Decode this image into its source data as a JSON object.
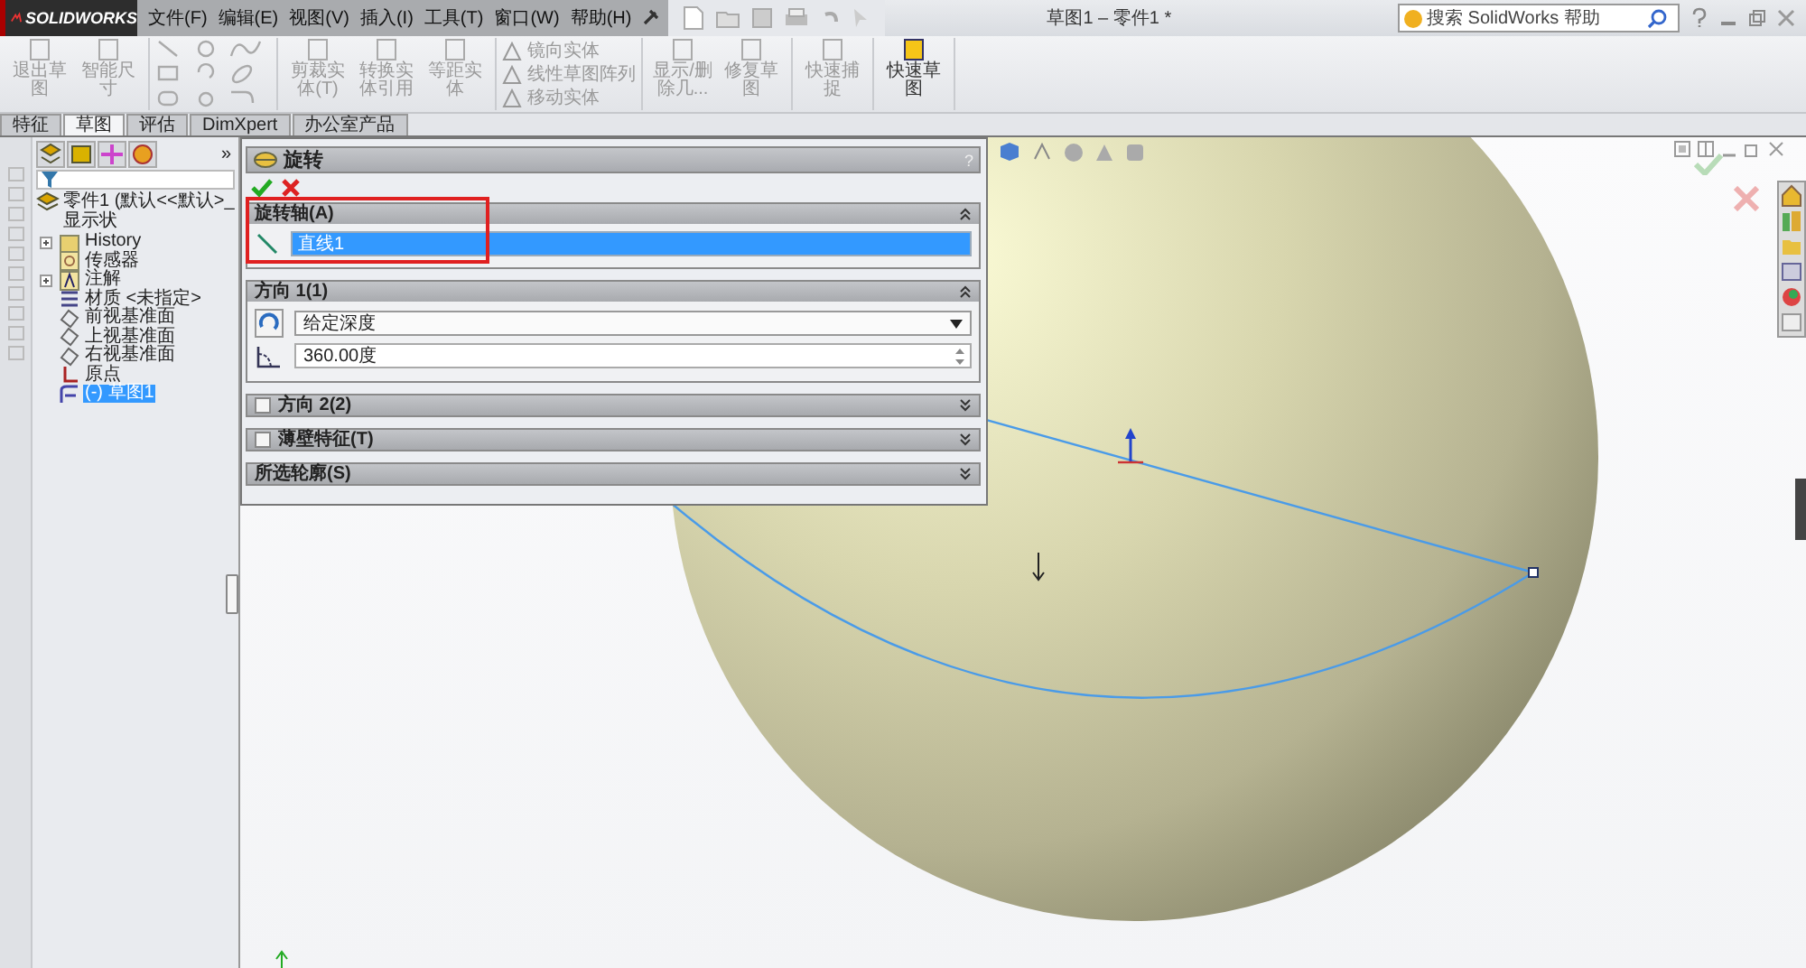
{
  "app": {
    "logo": "SOLIDWORKS",
    "title": "草图1 – 零件1 *",
    "search": {
      "placeholder": "搜索 SolidWorks 帮助"
    }
  },
  "menus": [
    {
      "label": "文件(F)"
    },
    {
      "label": "编辑(E)"
    },
    {
      "label": "视图(V)"
    },
    {
      "label": "插入(I)"
    },
    {
      "label": "工具(T)"
    },
    {
      "label": "窗口(W)"
    },
    {
      "label": "帮助(H)"
    }
  ],
  "ribbon": {
    "groups": [
      {
        "kind": "buttons",
        "buttons": [
          {
            "label": "退出草图",
            "disabled": true
          },
          {
            "label": "智能尺寸",
            "disabled": true
          }
        ]
      },
      {
        "kind": "sketch-tools"
      },
      {
        "kind": "buttons",
        "buttons": [
          {
            "label": "剪裁实体(T)",
            "disabled": true
          },
          {
            "label": "转换实体引用",
            "disabled": true
          },
          {
            "label": "等距实体",
            "disabled": true
          }
        ]
      },
      {
        "kind": "stack",
        "buttons": [
          {
            "label": "镜向实体",
            "disabled": true
          },
          {
            "label": "线性草图阵列",
            "disabled": true
          },
          {
            "label": "移动实体",
            "disabled": true
          }
        ]
      },
      {
        "kind": "buttons",
        "buttons": [
          {
            "label": "显示/删除几...",
            "disabled": true
          },
          {
            "label": "修复草图",
            "disabled": true
          }
        ]
      },
      {
        "kind": "buttons",
        "buttons": [
          {
            "label": "快速捕捉",
            "disabled": true
          }
        ]
      },
      {
        "kind": "buttons",
        "buttons": [
          {
            "label": "快速草图",
            "disabled": false
          }
        ]
      }
    ]
  },
  "tabs": [
    {
      "label": "特征",
      "selected": false
    },
    {
      "label": "草图",
      "selected": true
    },
    {
      "label": "评估",
      "selected": false
    },
    {
      "label": "DimXpert",
      "selected": false
    },
    {
      "label": "办公室产品",
      "selected": false
    }
  ],
  "tree": {
    "more": "»",
    "root": {
      "label": "零件1 (默认<<默认>_显示状",
      "children": [
        {
          "label": "History",
          "kind": "folder",
          "expandable": true,
          "selected": false
        },
        {
          "label": "传感器",
          "kind": "sensor",
          "expandable": false,
          "selected": false
        },
        {
          "label": "注解",
          "kind": "annotation",
          "expandable": true,
          "selected": false
        },
        {
          "label": "材质 <未指定>",
          "kind": "material",
          "expandable": false,
          "selected": false
        },
        {
          "label": "前视基准面",
          "kind": "plane",
          "expandable": false,
          "selected": false
        },
        {
          "label": "上视基准面",
          "kind": "plane",
          "expandable": false,
          "selected": false
        },
        {
          "label": "右视基准面",
          "kind": "plane",
          "expandable": false,
          "selected": false
        },
        {
          "label": "原点",
          "kind": "origin",
          "expandable": false,
          "selected": false
        },
        {
          "label": "(-) 草图1",
          "kind": "sketch",
          "expandable": false,
          "selected": true
        }
      ]
    }
  },
  "property_manager": {
    "title": "旋转",
    "help": "?",
    "sections": [
      {
        "kind": "axis",
        "title": "旋转轴(A)",
        "expanded": true,
        "highlighted": true,
        "value": "直线1",
        "value_selected": true
      },
      {
        "kind": "direction",
        "title": "方向 1(1)",
        "expanded": true,
        "end_condition": "给定深度",
        "angle": "360.00度"
      },
      {
        "title": "方向 2(2)",
        "expanded": false,
        "checked": false
      },
      {
        "title": "薄壁特征(T)",
        "expanded": false,
        "checked": false
      },
      {
        "title": "所选轮廓(S)",
        "expanded": false
      }
    ]
  }
}
